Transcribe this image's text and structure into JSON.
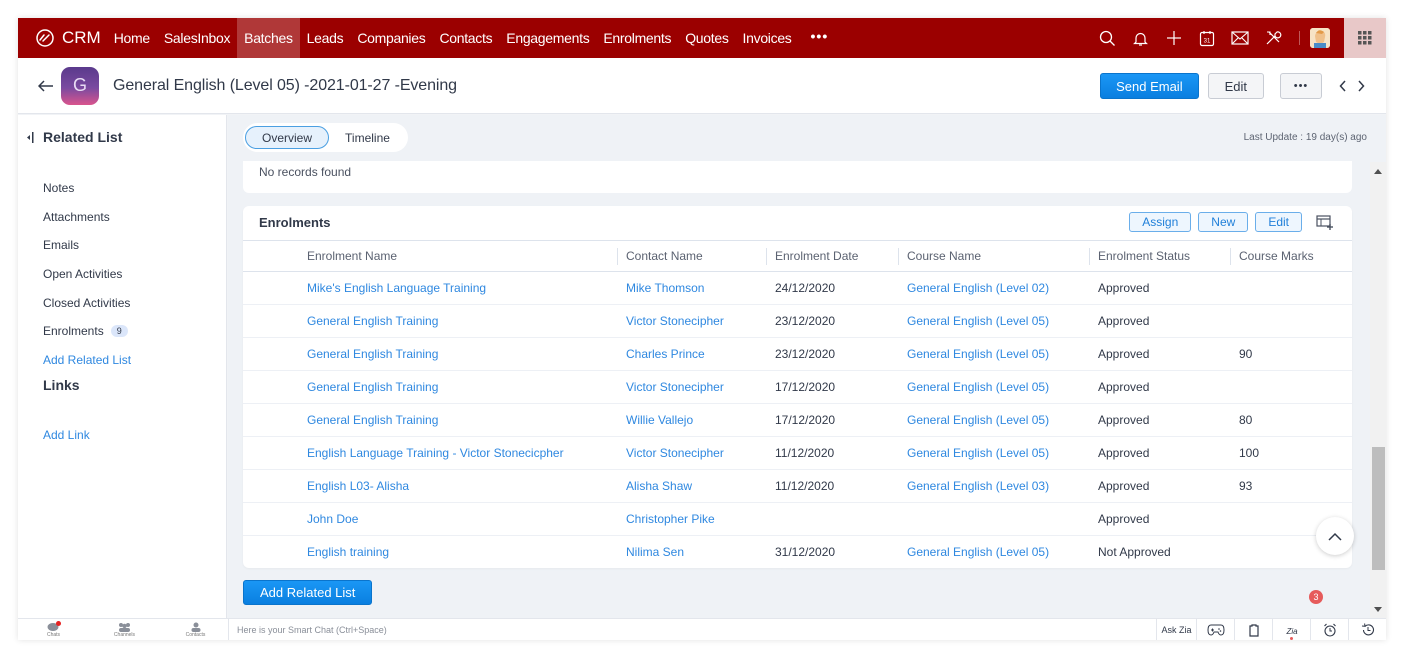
{
  "topnav": {
    "brand": "CRM",
    "items": [
      {
        "label": "Home",
        "active": false
      },
      {
        "label": "SalesInbox",
        "active": false
      },
      {
        "label": "Batches",
        "active": true
      },
      {
        "label": "Leads",
        "active": false
      },
      {
        "label": "Companies",
        "active": false
      },
      {
        "label": "Contacts",
        "active": false
      },
      {
        "label": "Engagements",
        "active": false
      },
      {
        "label": "Enrolments",
        "active": false
      },
      {
        "label": "Quotes",
        "active": false
      },
      {
        "label": "Invoices",
        "active": false
      }
    ],
    "more": "•••",
    "icons": [
      "search-icon",
      "bell-icon",
      "plus-icon",
      "calendar-icon",
      "mail-icon",
      "tools-icon"
    ],
    "accent_color": "#9b0000"
  },
  "record": {
    "avatar_letter": "G",
    "title": "General English (Level 05) -2021-01-27 -Evening",
    "send_email": "Send Email",
    "edit": "Edit",
    "more": "•••"
  },
  "sidebar": {
    "heading": "Related List",
    "items": [
      {
        "label": "Notes"
      },
      {
        "label": "Attachments"
      },
      {
        "label": "Emails"
      },
      {
        "label": "Open Activities"
      },
      {
        "label": "Closed Activities"
      },
      {
        "label": "Enrolments",
        "badge": "9"
      }
    ],
    "add_related": "Add Related List",
    "links_heading": "Links",
    "add_link": "Add Link"
  },
  "tabs": {
    "overview": "Overview",
    "timeline": "Timeline",
    "active": "Overview",
    "last_update": "Last Update : 19 day(s) ago"
  },
  "prev_section": {
    "empty_text": "No records found"
  },
  "enrolments": {
    "title": "Enrolments",
    "assign": "Assign",
    "new": "New",
    "edit": "Edit",
    "columns": [
      "Enrolment Name",
      "Contact Name",
      "Enrolment Date",
      "Course Name",
      "Enrolment Status",
      "Course Marks"
    ],
    "rows": [
      {
        "name": "Mike's English Language Training",
        "contact": "Mike Thomson",
        "date": "24/12/2020",
        "course": "General English (Level 02)",
        "status": "Approved",
        "marks": ""
      },
      {
        "name": "General English Training",
        "contact": "Victor Stonecipher",
        "date": "23/12/2020",
        "course": "General English (Level 05)",
        "status": "Approved",
        "marks": ""
      },
      {
        "name": "General English Training",
        "contact": "Charles Prince",
        "date": "23/12/2020",
        "course": "General English (Level 05)",
        "status": "Approved",
        "marks": "90"
      },
      {
        "name": "General English Training",
        "contact": "Victor Stonecipher",
        "date": "17/12/2020",
        "course": "General English (Level 05)",
        "status": "Approved",
        "marks": ""
      },
      {
        "name": "General English Training",
        "contact": "Willie Vallejo",
        "date": "17/12/2020",
        "course": "General English (Level 05)",
        "status": "Approved",
        "marks": "80"
      },
      {
        "name": "English Language Training - Victor Stonecicpher",
        "contact": "Victor Stonecipher",
        "date": "11/12/2020",
        "course": "General English (Level 05)",
        "status": "Approved",
        "marks": "100"
      },
      {
        "name": "English L03- Alisha",
        "contact": "Alisha Shaw",
        "date": "11/12/2020",
        "course": "General English (Level 03)",
        "status": "Approved",
        "marks": "93"
      },
      {
        "name": "John Doe",
        "contact": "Christopher Pike",
        "date": "",
        "course": "",
        "status": "Approved",
        "marks": ""
      },
      {
        "name": "English training",
        "contact": "Nilima Sen",
        "date": "31/12/2020",
        "course": "General English (Level 05)",
        "status": "Not Approved",
        "marks": ""
      }
    ]
  },
  "add_related_button": "Add Related List",
  "bottombar": {
    "tabs": [
      "Chats",
      "Channels",
      "Contacts"
    ],
    "smart_chat_placeholder": "Here is your Smart Chat (Ctrl+Space)",
    "ask_zia": "Ask Zia",
    "notification_count": "3"
  }
}
